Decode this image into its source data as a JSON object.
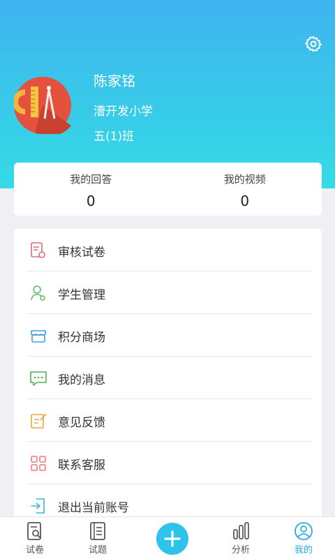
{
  "profile": {
    "name": "陈家铭",
    "school": "漕开发小学",
    "class": "五(1)班"
  },
  "stats": [
    {
      "label": "我的回答",
      "value": "0"
    },
    {
      "label": "我的视频",
      "value": "0"
    }
  ],
  "menu": [
    {
      "label": "审核试卷",
      "icon": "review-paper-icon"
    },
    {
      "label": "学生管理",
      "icon": "student-manage-icon"
    },
    {
      "label": "积分商场",
      "icon": "store-icon"
    },
    {
      "label": "我的消息",
      "icon": "message-icon"
    },
    {
      "label": "意见反馈",
      "icon": "feedback-icon"
    },
    {
      "label": "联系客服",
      "icon": "service-grid-icon"
    },
    {
      "label": "退出当前账号",
      "icon": "logout-icon"
    }
  ],
  "tabs": [
    {
      "label": "试卷",
      "icon": "paper-search-icon"
    },
    {
      "label": "试题",
      "icon": "questions-icon"
    },
    {
      "label": "分析",
      "icon": "bar-chart-icon"
    },
    {
      "label": "我的",
      "icon": "user-circle-icon",
      "active": true
    }
  ],
  "colors": {
    "header_top": "#40b4f0",
    "header_bottom": "#35dbe6",
    "accent": "#27a9e8",
    "avatar_bg": "#e4513d"
  }
}
